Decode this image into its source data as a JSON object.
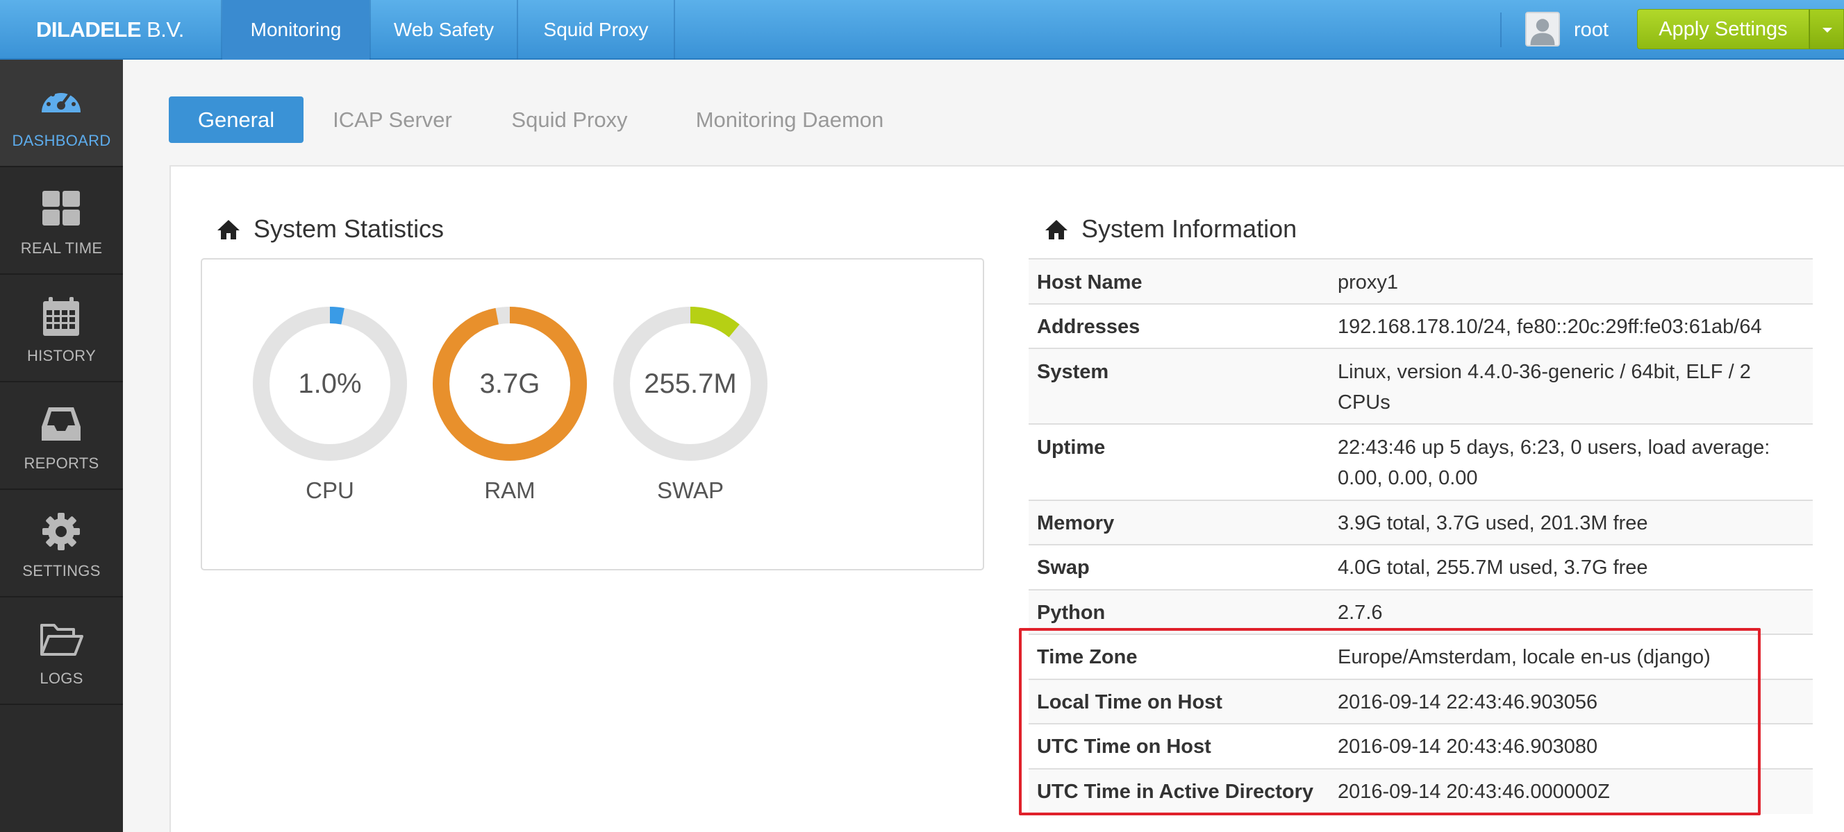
{
  "brand": {
    "bold": "DILADELE",
    "thin": "B.V."
  },
  "top_nav": [
    {
      "label": "Monitoring",
      "active": true
    },
    {
      "label": "Web Safety",
      "active": false
    },
    {
      "label": "Squid Proxy",
      "active": false
    }
  ],
  "user": {
    "name": "root",
    "avatar_icon": "user-avatar-icon"
  },
  "apply_button": {
    "label": "Apply Settings",
    "color": "#a3cc1e"
  },
  "sidebar": [
    {
      "label": "DASHBOARD",
      "icon": "dashboard-gauge-icon",
      "active": true
    },
    {
      "label": "REAL TIME",
      "icon": "grid-icon",
      "active": false
    },
    {
      "label": "HISTORY",
      "icon": "calendar-icon",
      "active": false
    },
    {
      "label": "REPORTS",
      "icon": "inbox-tray-icon",
      "active": false
    },
    {
      "label": "SETTINGS",
      "icon": "gear-icon",
      "active": false
    },
    {
      "label": "LOGS",
      "icon": "folder-open-icon",
      "active": false
    }
  ],
  "tabs": [
    {
      "label": "General",
      "active": true
    },
    {
      "label": "ICAP Server",
      "active": false
    },
    {
      "label": "Squid Proxy",
      "active": false
    },
    {
      "label": "Monitoring Daemon",
      "active": false
    }
  ],
  "stats": {
    "title": "System Statistics",
    "icon": "home-icon",
    "gauges": [
      {
        "label": "CPU",
        "value": "1.0%",
        "fraction": 0.03,
        "color": "#3a9be6"
      },
      {
        "label": "RAM",
        "value": "3.7G",
        "fraction": 0.97,
        "color": "#e8902c"
      },
      {
        "label": "SWAP",
        "value": "255.7M",
        "fraction": 0.11,
        "color": "#b6d014"
      }
    ]
  },
  "info": {
    "title": "System Information",
    "icon": "home-icon",
    "rows": [
      {
        "key": "Host Name",
        "value": "proxy1"
      },
      {
        "key": "Addresses",
        "value": "192.168.178.10/24, fe80::20c:29ff:fe03:61ab/64"
      },
      {
        "key": "System",
        "value": "Linux, version 4.4.0-36-generic / 64bit, ELF / 2 CPUs"
      },
      {
        "key": "Uptime",
        "value": "22:43:46 up 5 days, 6:23, 0 users, load average: 0.00, 0.00, 0.00"
      },
      {
        "key": "Memory",
        "value": "3.9G total, 3.7G used, 201.3M free"
      },
      {
        "key": "Swap",
        "value": "4.0G total, 255.7M used, 3.7G free"
      },
      {
        "key": "Python",
        "value": "2.7.6"
      },
      {
        "key": "Time Zone",
        "value": "Europe/Amsterdam, locale en-us (django)"
      },
      {
        "key": "Local Time on Host",
        "value": "2016-09-14 22:43:46.903056"
      },
      {
        "key": "UTC Time on Host",
        "value": "2016-09-14 20:43:46.903080"
      },
      {
        "key": "UTC Time in Active Directory",
        "value": "2016-09-14 20:43:46.000000Z"
      }
    ]
  },
  "highlight_color": "#e0212b"
}
